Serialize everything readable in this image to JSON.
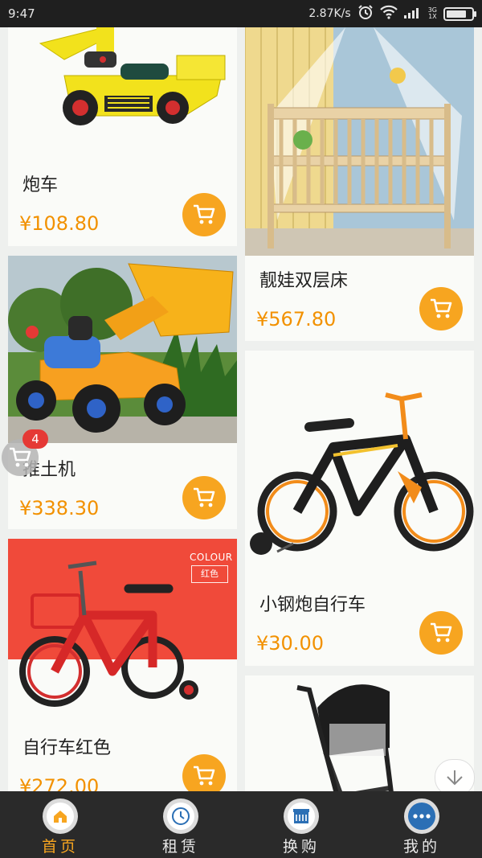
{
  "status_bar": {
    "time": "9:47",
    "net_speed": "2.87K/s",
    "signal_label_top": "3G",
    "signal_label_bottom": "1X",
    "battery_level": 0.85
  },
  "products": [
    {
      "name": "炮车",
      "price": "¥108.80",
      "image": "yellow-ride-on-digger-toy"
    },
    {
      "name": "靓娃双层床",
      "price": "¥567.80",
      "image": "wooden-baby-crib-with-net"
    },
    {
      "name": "推土机",
      "price": "¥338.30",
      "image": "orange-excavator-ride-on-toy"
    },
    {
      "name": "小钢炮自行车",
      "price": "¥30.00",
      "image": "black-orange-kids-bike"
    },
    {
      "name": "自行车红色",
      "price": "¥272.00",
      "image": "red-kids-bike"
    },
    {
      "name": "",
      "price": "",
      "image": "black-baby-stroller"
    }
  ],
  "promo": {
    "colour_label": "COLOUR",
    "color_tag": "红色"
  },
  "floating_cart": {
    "badge_count": "4"
  },
  "bottom_nav": {
    "items": [
      {
        "label": "首页",
        "icon": "home-icon",
        "active": true
      },
      {
        "label": "租赁",
        "icon": "clock-icon",
        "active": false
      },
      {
        "label": "换购",
        "icon": "hotel-icon",
        "active": false
      },
      {
        "label": "我的",
        "icon": "more-dots-icon",
        "active": false
      }
    ]
  },
  "colors": {
    "accent": "#f7a520",
    "price": "#f29100",
    "nav_bg": "#2a2a2a",
    "badge": "#e53935"
  }
}
